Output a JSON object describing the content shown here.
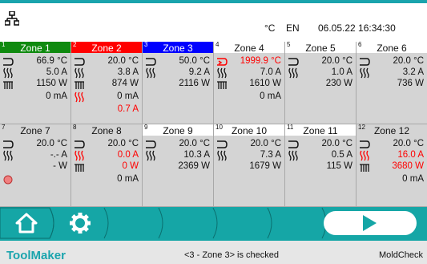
{
  "header": {
    "unit": "°C",
    "language": "EN",
    "datetime": "06.05.22 16:34:30"
  },
  "zones": [
    {
      "num": "1",
      "name": "Zone 1",
      "temp": "66.9 °C",
      "current": "5.0 A",
      "power": "1150 W",
      "sensor": "0 mA",
      "head_bg": "#0f8a0f",
      "head_fg": "#ffffff",
      "temp_color": "#111111",
      "current_color": "#111111",
      "power_color": "#111111",
      "row1_icon": "arrows-icon",
      "row2_icon": "heater-icon",
      "row3_icon": "sensor-icon",
      "row4_icon": "",
      "row1_val": "66.9 °C",
      "row2_val": "5.0 A",
      "row3_val": "1150 W",
      "row4_val": "0 mA"
    },
    {
      "num": "2",
      "name": "Zone 2",
      "head_bg": "#ff0000",
      "head_fg": "#ffffff",
      "row1_icon": "arrows-icon",
      "row2_icon": "heater-icon",
      "row3_icon": "sensor-icon",
      "row4_icon": "fault-heater-icon",
      "row1_val": "20.0 °C",
      "row2_val": "3.8 A",
      "row3_val": "874 W",
      "row4_val": "0 mA",
      "row5_val": "0.7 A",
      "row5_color": "#ff0000"
    },
    {
      "num": "3",
      "name": "Zone 3",
      "head_bg": "#0000ff",
      "head_fg": "#ffffff",
      "row1_icon": "arrows-icon",
      "row2_icon": "heater-icon",
      "row1_val": "50.0 °C",
      "row2_val": "9.2 A",
      "row3_val": "2116 W"
    },
    {
      "num": "4",
      "name": "Zone 4",
      "head_bg": "#ffffff",
      "head_fg": "#111111",
      "row1_icon": "alarm-arrows-icon",
      "row2_icon": "heater-icon",
      "row3_icon": "sensor-icon",
      "row1_val": "1999.9 °C",
      "row1_color": "#ff0000",
      "row2_val": "7.0 A",
      "row3_val": "1610 W",
      "row4_val": "0 mA"
    },
    {
      "num": "5",
      "name": "Zone 5",
      "head_bg": "#ffffff",
      "head_fg": "#111111",
      "row1_icon": "arrows-icon",
      "row2_icon": "heater-icon",
      "row1_val": "20.0 °C",
      "row2_val": "1.0 A",
      "row3_val": "230 W"
    },
    {
      "num": "6",
      "name": "Zone 6",
      "head_bg": "#ffffff",
      "head_fg": "#111111",
      "row1_icon": "arrows-icon",
      "row2_icon": "heater-icon",
      "row1_val": "20.0 °C",
      "row2_val": "3.2 A",
      "row3_val": "736 W"
    },
    {
      "num": "7",
      "name": "Zone 7",
      "head_bg": "#d4d4d4",
      "head_fg": "#111111",
      "row1_icon": "arrows-icon",
      "row2_icon": "heater-icon",
      "row4_icon": "error-dot-icon",
      "row1_val": "20.0 °C",
      "row2_val": "-.- A",
      "row3_val": "- W"
    },
    {
      "num": "8",
      "name": "Zone 8",
      "head_bg": "#d4d4d4",
      "head_fg": "#111111",
      "row1_icon": "arrows-icon",
      "row2_icon": "fault-heater-icon",
      "row3_icon": "sensor-icon",
      "row1_val": "20.0 °C",
      "row2_val": "0.0 A",
      "row2_color": "#ff0000",
      "row3_val": "0 W",
      "row3_color": "#ff0000",
      "row4_val": "0 mA"
    },
    {
      "num": "9",
      "name": "Zone 9",
      "head_bg": "#ffffff",
      "head_fg": "#111111",
      "row1_icon": "arrows-icon",
      "row2_icon": "heater-icon",
      "row1_val": "20.0 °C",
      "row2_val": "10.3 A",
      "row3_val": "2369 W"
    },
    {
      "num": "10",
      "name": "Zone 10",
      "head_bg": "#ffffff",
      "head_fg": "#111111",
      "row1_icon": "arrows-icon",
      "row2_icon": "heater-icon",
      "row1_val": "20.0 °C",
      "row2_val": "7.3 A",
      "row3_val": "1679 W"
    },
    {
      "num": "11",
      "name": "Zone 11",
      "head_bg": "#ffffff",
      "head_fg": "#111111",
      "row1_icon": "arrows-icon",
      "row2_icon": "heater-icon",
      "row1_val": "20.0 °C",
      "row2_val": "0.5 A",
      "row3_val": "115 W"
    },
    {
      "num": "12",
      "name": "Zone 12",
      "head_bg": "#d4d4d4",
      "head_fg": "#111111",
      "row1_icon": "arrows-icon",
      "row2_icon": "fault-heater-icon",
      "row3_icon": "sensor-icon",
      "row1_val": "20.0 °C",
      "row2_val": "16.0 A",
      "row2_color": "#ff0000",
      "row3_val": "3680 W",
      "row3_color": "#ff0000",
      "row4_val": "0 mA"
    }
  ],
  "nav": {
    "home": "home-icon",
    "settings": "gear-icon",
    "play": "play-icon"
  },
  "status": {
    "brand": "ToolMaker",
    "message": "<3 - Zone 3> is checked",
    "mode": "MoldCheck"
  },
  "colors": {
    "accent": "#1aa4ad",
    "nav": "#15a6a6",
    "alarm": "#ff0000"
  }
}
